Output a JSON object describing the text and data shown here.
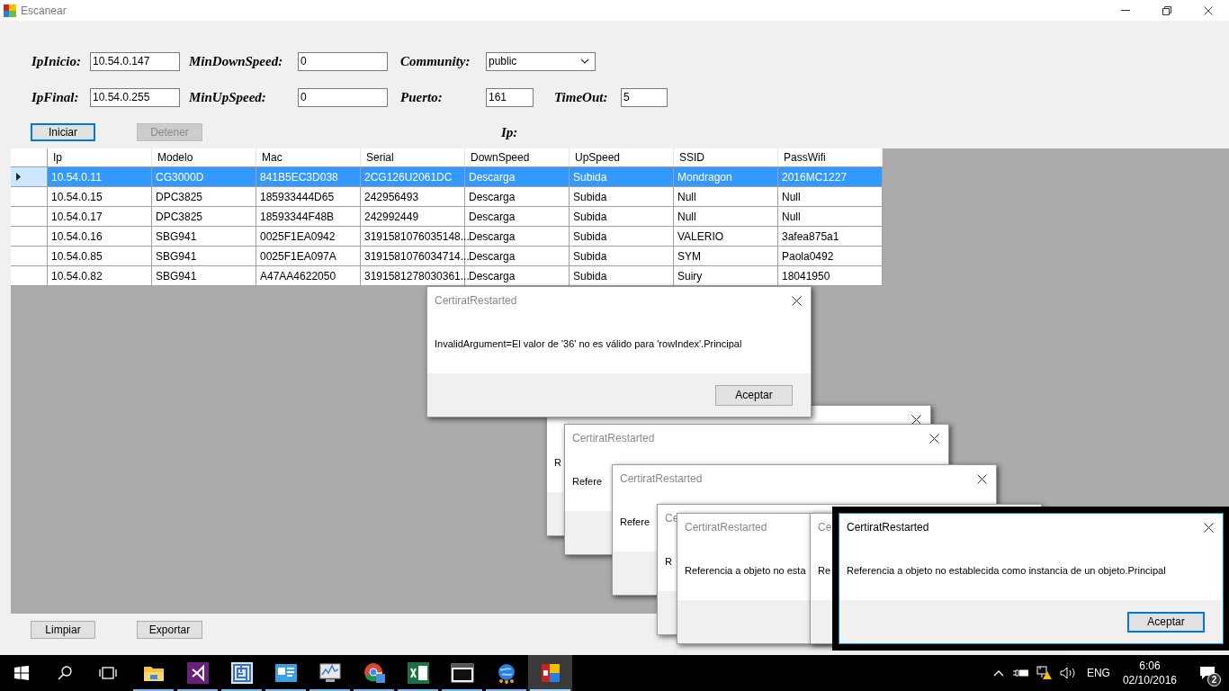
{
  "window": {
    "title": "Escanear"
  },
  "form": {
    "rows": [
      [
        {
          "label": "IpInicio:",
          "value": "10.54.0.147",
          "kind": "text"
        },
        {
          "label": "MinDownSpeed:",
          "value": "0",
          "kind": "text"
        },
        {
          "label": "Community:",
          "value": "public",
          "kind": "select"
        }
      ],
      [
        {
          "label": "IpFinal:",
          "value": "10.54.0.255",
          "kind": "text"
        },
        {
          "label": "MinUpSpeed:",
          "value": "0",
          "kind": "text"
        },
        {
          "label": "Puerto:",
          "value": "161",
          "kind": "text"
        },
        {
          "label": "TimeOut:",
          "value": "5",
          "kind": "text"
        }
      ]
    ],
    "buttons": [
      {
        "label": "Iniciar",
        "disabled": false,
        "focused": true
      },
      {
        "label": "Detener",
        "disabled": true,
        "focused": false
      }
    ],
    "ip_label": "Ip:"
  },
  "table": {
    "columns": [
      "Ip",
      "Modelo",
      "Mac",
      "Serial",
      "DownSpeed",
      "UpSpeed",
      "SSID",
      "PassWifi"
    ],
    "rows": [
      {
        "selected": true,
        "cells": [
          "10.54.0.11",
          "CG3000D",
          "841B5EC3D038",
          "2CG126U2061DC",
          "Descarga",
          "Subida",
          "Mondragon",
          "2016MC1227"
        ]
      },
      {
        "selected": false,
        "cells": [
          "10.54.0.15",
          "DPC3825",
          "185933444D65",
          "242956493",
          "Descarga",
          "Subida",
          "Null",
          "Null"
        ]
      },
      {
        "selected": false,
        "cells": [
          "10.54.0.17",
          "DPC3825",
          "18593344F48B",
          "242992449",
          "Descarga",
          "Subida",
          "Null",
          "Null"
        ]
      },
      {
        "selected": false,
        "cells": [
          "10.54.0.16",
          "SBG941",
          "0025F1EA0942",
          "3191581076035148...",
          "Descarga",
          "Subida",
          "VALERIO",
          "3afea875a1"
        ]
      },
      {
        "selected": false,
        "cells": [
          "10.54.0.85",
          "SBG941",
          "0025F1EA097A",
          "3191581076034714...",
          "Descarga",
          "Subida",
          "SYM",
          "Paola0492"
        ]
      },
      {
        "selected": false,
        "cells": [
          "10.54.0.82",
          "SBG941",
          "A47AA4622050",
          "3191581278030361...",
          "Descarga",
          "Subida",
          "Suiry",
          "18041950"
        ]
      }
    ]
  },
  "bottom_buttons": [
    "Limpiar",
    "Exportar"
  ],
  "dialogs": [
    {
      "message": "R",
      "close_shown": true
    },
    {
      "title": "CertiratRestarted",
      "message": "Refere",
      "close_shown": true
    },
    {
      "title": "CertiratRestarted",
      "message": "Refere",
      "close_shown": true
    },
    {
      "title": "Ce",
      "message": "R"
    },
    {
      "title": "CertiratRestarted",
      "message": "Referencia a objeto no esta"
    },
    {
      "title": "Ce",
      "message": "Re"
    },
    {
      "title": "CertiratRestarted",
      "message": "Referencia a objeto no establecida como instancia de un objeto.Principal",
      "close_shown": true,
      "button": "Aceptar",
      "active": true
    },
    {
      "title": "CertiratRestarted",
      "message": "InvalidArgument=El valor de '36' no es válido para 'rowIndex'.Principal",
      "close_shown": true,
      "button": "Aceptar",
      "active": false
    }
  ],
  "taskbar": {
    "apps": [
      {
        "running": true,
        "active": false
      },
      {
        "running": true,
        "active": false
      },
      {
        "running": true,
        "active": false
      },
      {
        "running": true,
        "active": false
      },
      {
        "running": true,
        "active": false
      },
      {
        "running": true,
        "active": false
      },
      {
        "running": true,
        "active": false
      },
      {
        "running": true,
        "active": false
      },
      {
        "running": true,
        "active": false
      },
      {
        "running": true,
        "active": true
      }
    ],
    "language": "ENG",
    "time": "6:06",
    "date": "02/10/2016",
    "notifications": "2"
  }
}
